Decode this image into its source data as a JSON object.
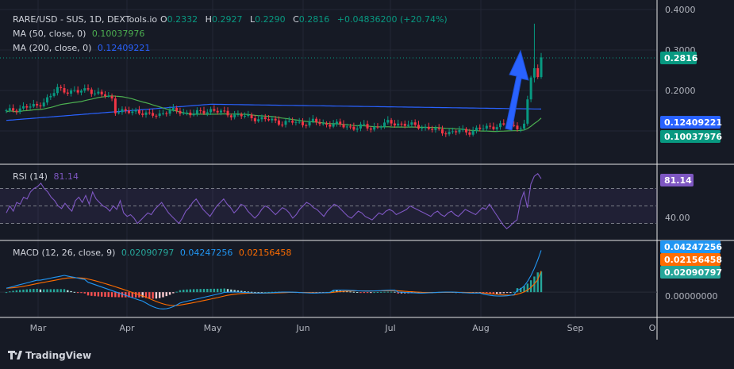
{
  "chart_data": {
    "type": "candlestick",
    "symbol_line": "RARE/USD - SUS, 1D, DEXTools.io",
    "ohlc": {
      "open_label": "O",
      "open": "0.2332",
      "high_label": "H",
      "high": "0.2927",
      "low_label": "L",
      "low": "0.2290",
      "close_label": "C",
      "close": "0.2816",
      "change": "+0.04836200 (+20.74%)"
    },
    "ma50": {
      "label": "MA (50, close, 0)",
      "value": "0.10037976",
      "color": "#4caf50"
    },
    "ma200": {
      "label": "MA (200, close, 0)",
      "value": "0.12409221",
      "color": "#2962ff"
    },
    "price_axis": {
      "ticks": [
        "0.4000",
        "0.3000",
        "0.2000"
      ],
      "ylim": [
        0.02,
        0.4
      ]
    },
    "price_badges": {
      "last": {
        "value": "0.2816",
        "color": "#089981"
      },
      "ma200": {
        "value": "0.12409221",
        "color": "#2962ff"
      },
      "ma50": {
        "value": "0.10037976",
        "color": "#089981"
      }
    },
    "x_axis": {
      "ticks": [
        "Mar",
        "Apr",
        "May",
        "Jun",
        "Jul",
        "Aug",
        "Sep",
        "O"
      ]
    },
    "up_color": "#089981",
    "down_color": "#f23645",
    "rsi": {
      "label": "RSI (14)",
      "value": "81.14",
      "color": "#7e57c2",
      "axis_tick": "40.00",
      "ylim": [
        15,
        95
      ],
      "band": [
        30,
        70
      ],
      "mid": 50,
      "points": [
        42,
        50,
        44,
        54,
        52,
        60,
        58,
        66,
        70,
        72,
        76,
        70,
        66,
        60,
        56,
        50,
        47,
        53,
        48,
        44,
        56,
        60,
        54,
        62,
        52,
        66,
        58,
        54,
        50,
        48,
        44,
        50,
        46,
        56,
        42,
        38,
        40,
        36,
        30,
        34,
        38,
        42,
        40,
        46,
        50,
        54,
        48,
        42,
        38,
        34,
        30,
        36,
        44,
        48,
        54,
        58,
        52,
        46,
        42,
        38,
        44,
        50,
        54,
        58,
        52,
        48,
        42,
        46,
        52,
        50,
        44,
        40,
        36,
        40,
        46,
        50,
        48,
        44,
        40,
        44,
        48,
        46,
        42,
        36,
        40,
        46,
        50,
        54,
        52,
        48,
        46,
        42,
        38,
        44,
        48,
        52,
        50,
        46,
        42,
        38,
        36,
        40,
        44,
        42,
        38,
        36,
        34,
        38,
        42,
        40,
        44,
        46,
        44,
        40,
        42,
        44,
        46,
        50,
        48,
        46,
        44,
        42,
        40,
        38,
        42,
        44,
        40,
        38,
        42,
        44,
        40,
        38,
        42,
        46,
        44,
        42,
        40,
        44,
        48,
        46,
        52,
        46,
        40,
        34,
        28,
        24,
        27,
        31,
        34,
        55,
        66,
        48,
        75,
        84,
        87,
        81.14
      ]
    },
    "macd": {
      "label": "MACD (12, 26, close, 9)",
      "hist_value": "0.02090797",
      "macd_value": "0.04247256",
      "signal_value": "0.02156458",
      "hist_color": "#26a69a",
      "macd_color": "#2196f3",
      "signal_color": "#ff6d00",
      "axis_tick": "0.00000000",
      "ylim": [
        -0.024,
        0.05
      ]
    },
    "watermark": "TradingView"
  }
}
